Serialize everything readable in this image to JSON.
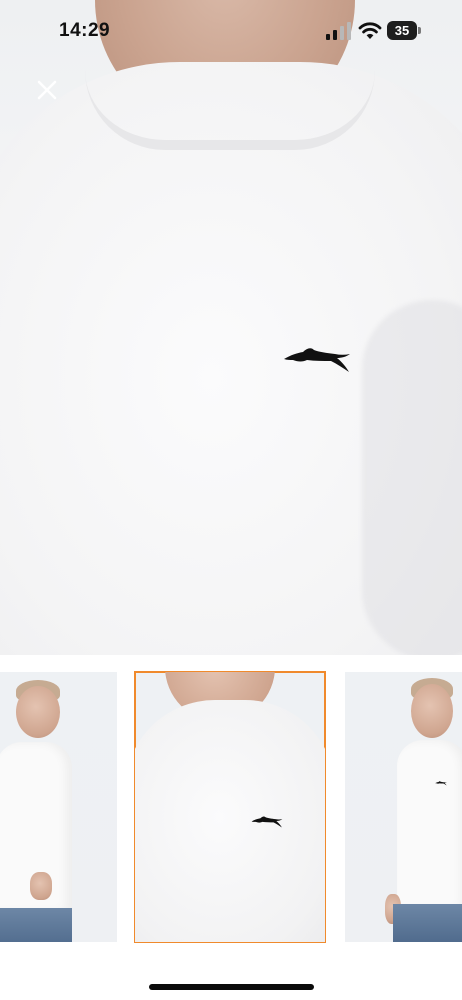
{
  "status_bar": {
    "time": "14:29",
    "battery": "35",
    "icons": [
      "cellular-signal-icon",
      "wifi-icon",
      "battery-icon"
    ]
  },
  "viewer": {
    "close_icon": "close-icon",
    "image": "white-tshirt-closeup-with-cheetah-logo"
  },
  "thumbnails": {
    "selected_index": 1,
    "accent_color": "#f08a2c",
    "items": [
      "model-side-view",
      "chest-closeup",
      "model-looking-down"
    ]
  },
  "colors": {
    "background": "#ffffff",
    "accent": "#f08a2c",
    "logo": "#111111"
  }
}
